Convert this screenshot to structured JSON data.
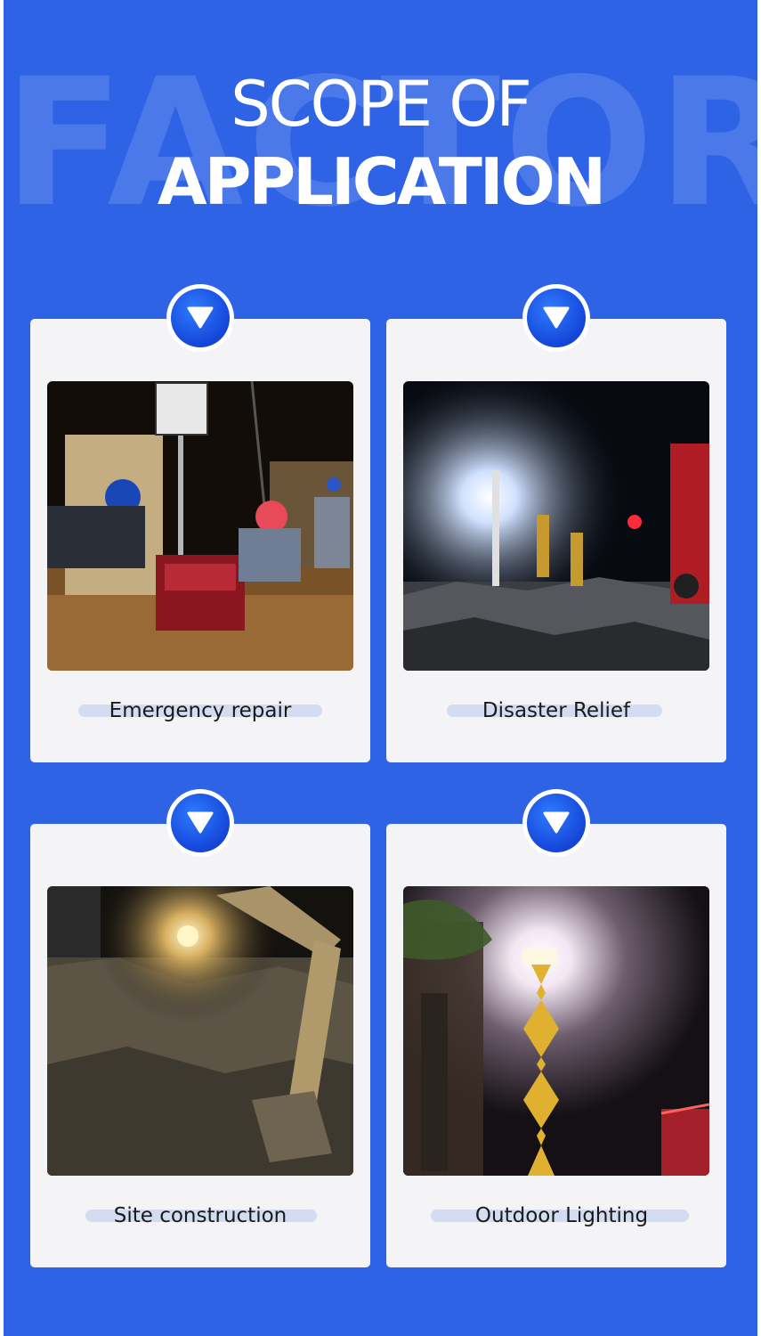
{
  "header": {
    "watermark": "FACTORY",
    "title_line1": "SCOPE OF",
    "title_line2": "APPLICATION"
  },
  "colors": {
    "background": "#2f63e6",
    "card": "#f4f4f6",
    "badge": "#1446d8",
    "label_highlight": "#d3dcf1"
  },
  "cards": [
    {
      "label": "Emergency repair",
      "icon": "chevron-down-icon"
    },
    {
      "label": "Disaster Relief",
      "icon": "chevron-down-icon"
    },
    {
      "label": "Site construction",
      "icon": "chevron-down-icon"
    },
    {
      "label": "Outdoor Lighting",
      "icon": "chevron-down-icon"
    }
  ]
}
